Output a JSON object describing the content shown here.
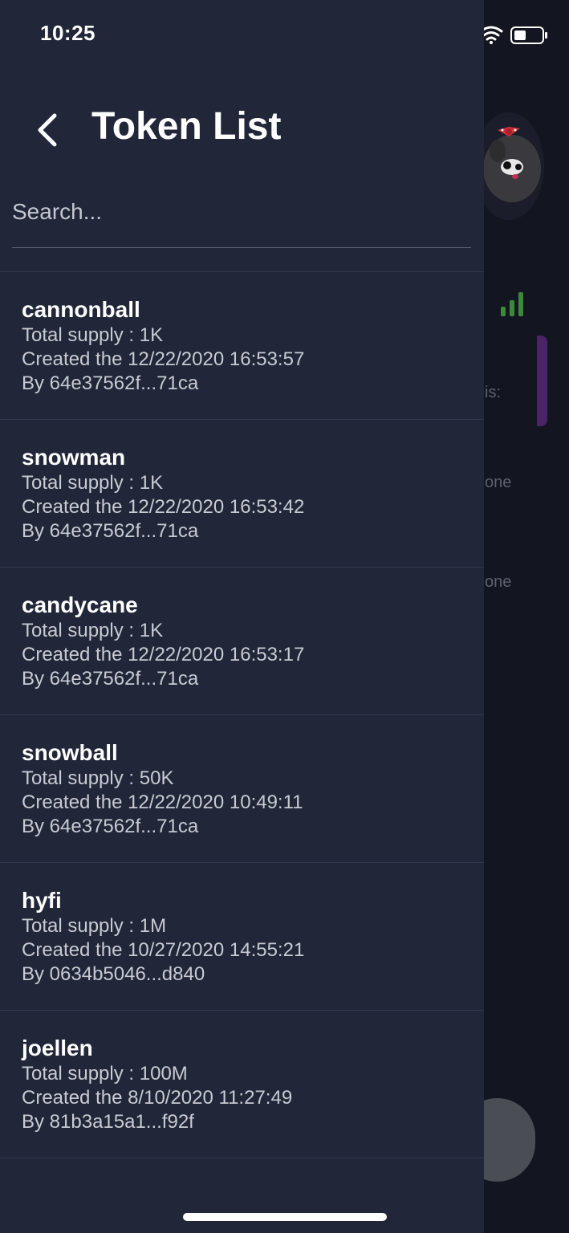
{
  "status_bar": {
    "time": "10:25"
  },
  "header": {
    "title": "Token List"
  },
  "search": {
    "placeholder": "Search...",
    "value": ""
  },
  "tokens": [
    {
      "name": "cannonball",
      "supply": "Total supply : 1K",
      "created": "Created the 12/22/2020 16:53:57",
      "by": "By 64e37562f...71ca"
    },
    {
      "name": "snowman",
      "supply": "Total supply : 1K",
      "created": "Created the 12/22/2020 16:53:42",
      "by": "By 64e37562f...71ca"
    },
    {
      "name": "candycane",
      "supply": "Total supply : 1K",
      "created": "Created the 12/22/2020 16:53:17",
      "by": "By 64e37562f...71ca"
    },
    {
      "name": "snowball",
      "supply": "Total supply : 50K",
      "created": "Created the 12/22/2020 10:49:11",
      "by": "By 64e37562f...71ca"
    },
    {
      "name": "hyfi",
      "supply": "Total supply : 1M",
      "created": "Created the 10/27/2020 14:55:21",
      "by": "By 0634b5046...d840"
    },
    {
      "name": "joellen",
      "supply": "Total supply : 100M",
      "created": "Created the 8/10/2020 11:27:49",
      "by": "By 81b3a15a1...f92f"
    }
  ],
  "background": {
    "partial_texts": [
      "is:",
      "one",
      "one"
    ]
  },
  "colors": {
    "drawer_bg": "#212639",
    "background": "#131520",
    "signal_green": "#3b8a3a",
    "accent_purple": "#4a2466"
  }
}
